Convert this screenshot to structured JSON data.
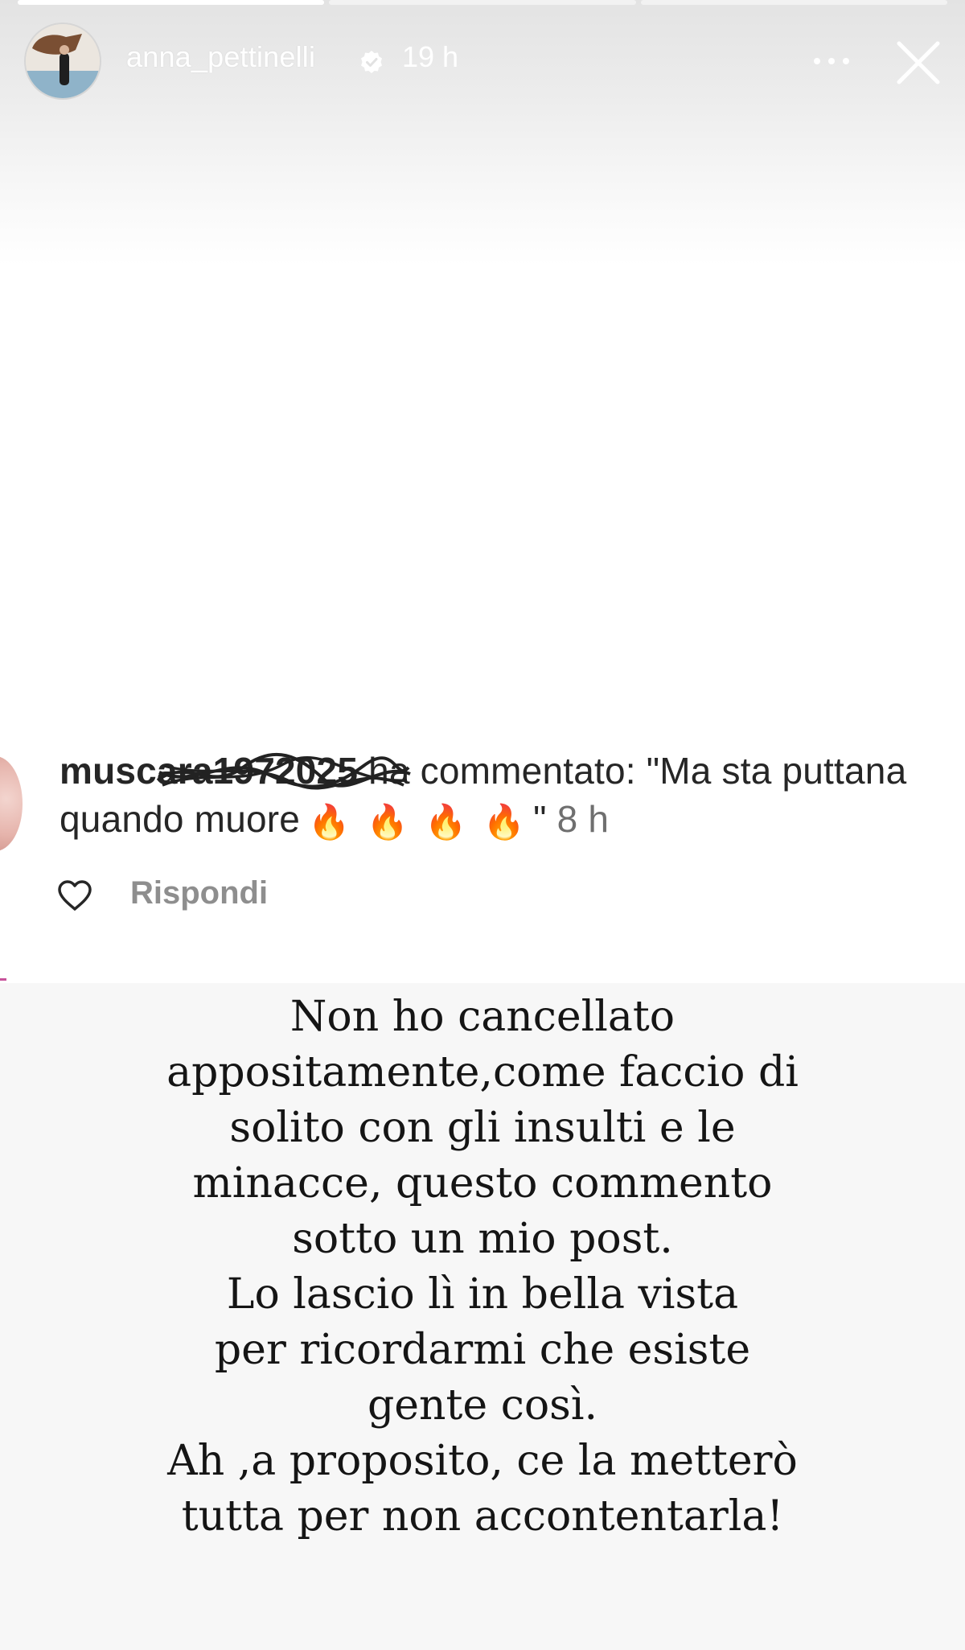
{
  "story": {
    "progress_bars": [
      {
        "state": "viewed",
        "progress": 1.0
      },
      {
        "state": "current",
        "progress": 0.0
      },
      {
        "state": "upcoming",
        "progress": 0.0
      }
    ],
    "header": {
      "username": "anna_pettinelli",
      "verified": true,
      "time": "19 h",
      "more_icon": "more-horizontal-icon",
      "close_icon": "close-icon"
    }
  },
  "comment": {
    "username_visible": "muscara1972025",
    "action": "ha commentato: \"Ma sta puttana quando muore",
    "emoji": [
      "🔥",
      "🔥",
      "🔥",
      "🔥"
    ],
    "closing_quote": "\"",
    "time": "8 h",
    "like_icon": "heart-outline-icon",
    "reply_label": "Rispondi"
  },
  "caption": {
    "lines": [
      "Non ho cancellato",
      "appositamente,come faccio di",
      "solito con gli insulti e le",
      "minacce, questo commento",
      "sotto un mio post.",
      "Lo lascio lì in bella vista",
      "per ricordarmi che esiste",
      "gente così.",
      "Ah ,a proposito, ce la metterò",
      "tutta per non accontentarla!"
    ]
  },
  "colors": {
    "header_text": "#ffffff",
    "comment_text": "#262626",
    "secondary_text": "#8e8e8e",
    "caption_text": "#151515",
    "caption_bg": "#f7f7f7",
    "verified_badge": "#ffffff"
  }
}
